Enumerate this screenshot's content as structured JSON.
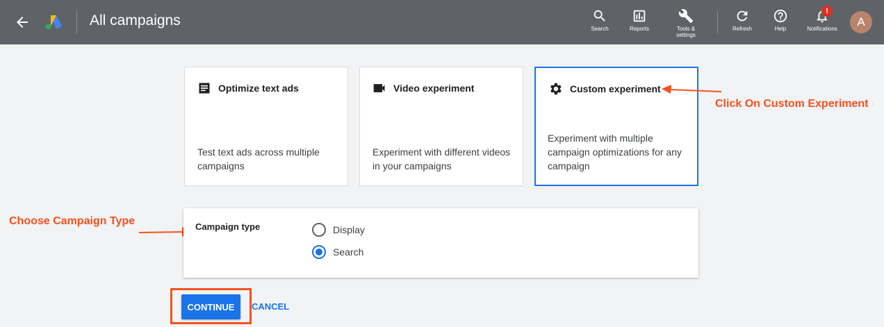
{
  "header": {
    "title": "All campaigns",
    "tools": [
      {
        "label": "Search"
      },
      {
        "label": "Reports"
      },
      {
        "label": "Tools &",
        "label2": "settings"
      },
      {
        "label": "Refresh"
      },
      {
        "label": "Help"
      },
      {
        "label": "Notifications",
        "badge": "!"
      }
    ],
    "avatar_letter": "A"
  },
  "cards": [
    {
      "title": "Optimize text ads",
      "description": "Test text ads across multiple campaigns"
    },
    {
      "title": "Video experiment",
      "description": "Experiment with different videos in your campaigns"
    },
    {
      "title": "Custom experiment",
      "description": "Experiment with multiple campaign optimizations for any campaign",
      "selected": true
    }
  ],
  "campaign_type": {
    "label": "Campaign type",
    "options": [
      {
        "label": "Display",
        "selected": false
      },
      {
        "label": "Search",
        "selected": true
      }
    ]
  },
  "actions": {
    "continue_label": "CONTINUE",
    "cancel_label": "CANCEL"
  },
  "annotations": {
    "custom_experiment": "Click On Custom Experiment",
    "campaign_type": "Choose Campaign Type"
  },
  "colors": {
    "header_bg": "#5f6368",
    "accent": "#1a73e8",
    "annotation": "#f4511e",
    "badge": "#d93025"
  }
}
